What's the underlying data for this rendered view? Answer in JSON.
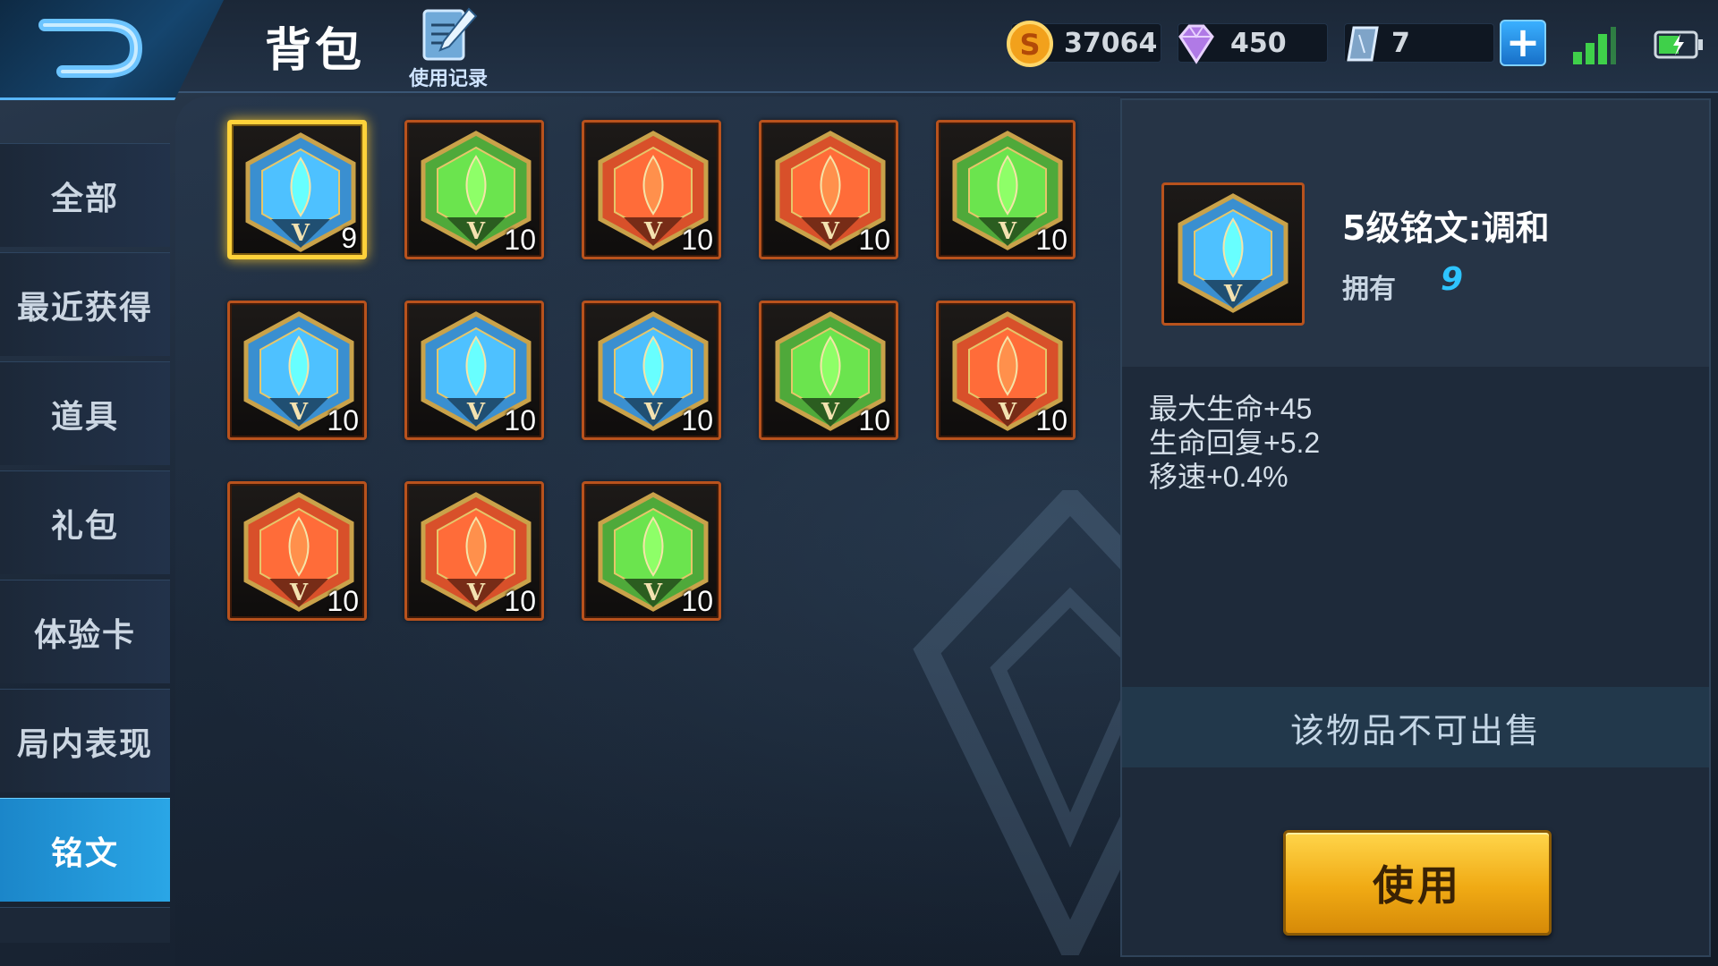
{
  "header": {
    "title": "背包",
    "history_label": "使用记录",
    "back_icon": "back-arrow-icon"
  },
  "currencies": [
    {
      "name": "gold-coin",
      "icon": "gold-coin-icon",
      "value": "37064"
    },
    {
      "name": "diamond",
      "icon": "diamond-icon",
      "value": "450"
    },
    {
      "name": "voucher",
      "icon": "crystal-icon",
      "value": "7"
    }
  ],
  "status": {
    "signal_icon": "signal-icon",
    "battery_icon": "battery-icon"
  },
  "sidebar": {
    "items": [
      {
        "label": "全部",
        "active": false
      },
      {
        "label": "最近获得",
        "active": false
      },
      {
        "label": "道具",
        "active": false
      },
      {
        "label": "礼包",
        "active": false
      },
      {
        "label": "体验卡",
        "active": false
      },
      {
        "label": "局内表现",
        "active": false
      },
      {
        "label": "铭文",
        "active": true
      }
    ]
  },
  "inscriptions": [
    {
      "icon": "blue-teardrop-icon",
      "color": "blue",
      "level": "V",
      "count": "9",
      "selected": true
    },
    {
      "icon": "green-shield-icon",
      "color": "green",
      "level": "V",
      "count": "10"
    },
    {
      "icon": "red-pillar-icon",
      "color": "red",
      "level": "V",
      "count": "10"
    },
    {
      "icon": "red-flower-icon",
      "color": "red",
      "level": "V",
      "count": "10"
    },
    {
      "icon": "green-gate-icon",
      "color": "green",
      "level": "V",
      "count": "10"
    },
    {
      "icon": "blue-heart-icon",
      "color": "blue",
      "level": "V",
      "count": "10"
    },
    {
      "icon": "blue-lightning-icon",
      "color": "blue",
      "level": "V",
      "count": "10"
    },
    {
      "icon": "blue-cross-icon",
      "color": "blue",
      "level": "V",
      "count": "10"
    },
    {
      "icon": "green-leaf-icon",
      "color": "green",
      "level": "V",
      "count": "10"
    },
    {
      "icon": "red-flower-icon",
      "color": "red",
      "level": "V",
      "count": "10"
    },
    {
      "icon": "red-shard-icon",
      "color": "red",
      "level": "V",
      "count": "10"
    },
    {
      "icon": "red-pillar-icon",
      "color": "red",
      "level": "V",
      "count": "10"
    },
    {
      "icon": "green-star-icon",
      "color": "green",
      "level": "V",
      "count": "10"
    }
  ],
  "detail": {
    "icon": "blue-teardrop-icon",
    "name": "5级铭文:调和",
    "own_label": "拥有",
    "own_count": "9",
    "stats": [
      "最大生命+45",
      "生命回复+5.2",
      "移速+0.4%"
    ],
    "sell_note": "该物品不可出售",
    "use_label": "使用"
  },
  "colors": {
    "blue": "#3a8fd0",
    "green": "#4fa93a",
    "red": "#d8502a",
    "accent": "#2aa6e6",
    "selected_border": "#ffd23a",
    "own_count": "#2ec4ff"
  }
}
